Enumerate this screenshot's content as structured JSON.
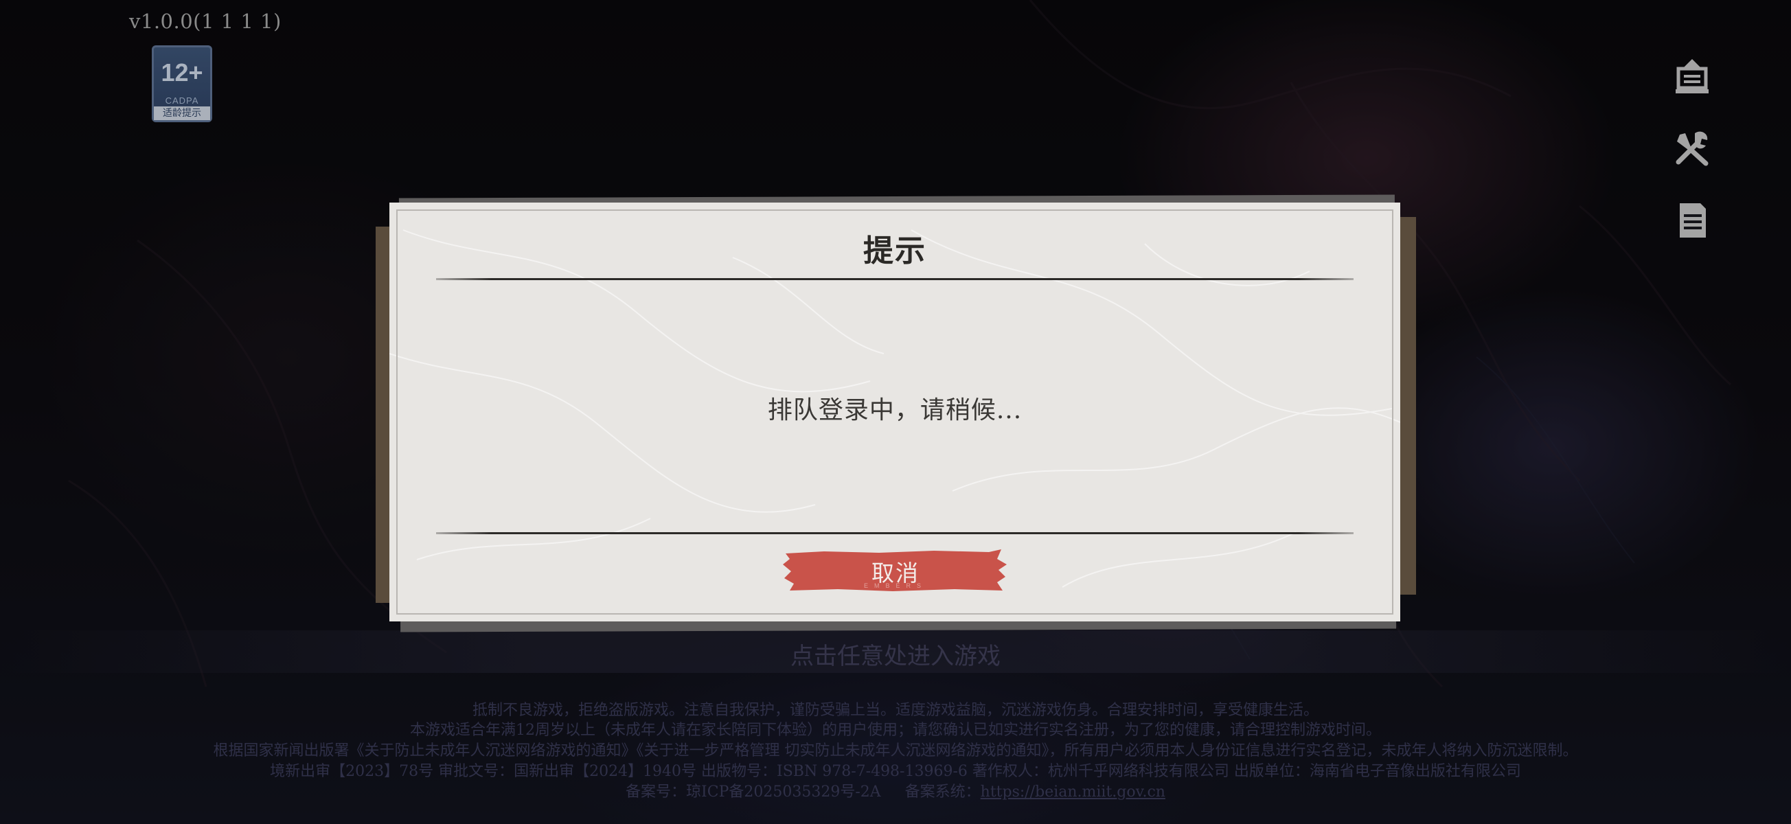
{
  "header": {
    "version": "v1.0.0(1 1 1 1)"
  },
  "age_rating": {
    "number": "12+",
    "org": "CADPA",
    "tip": "适龄提示"
  },
  "side_tools": [
    {
      "name": "notice-icon"
    },
    {
      "name": "repair-tools-icon"
    },
    {
      "name": "document-icon"
    }
  ],
  "dialog": {
    "title": "提示",
    "message": "排队登录中，请稍候...",
    "cancel_label": "取消",
    "cancel_sub": "EMBERS"
  },
  "bottom": {
    "enter_prompt": "点击任意处进入游戏",
    "legal_lines": [
      "抵制不良游戏，拒绝盗版游戏。注意自我保护，谨防受骗上当。适度游戏益脑，沉迷游戏伤身。合理安排时间，享受健康生活。",
      "本游戏适合年满12周岁以上（未成年人请在家长陪同下体验）的用户使用；请您确认已如实进行实名注册，为了您的健康，请合理控制游戏时间。",
      "根据国家新闻出版署《关于防止未成年人沉迷网络游戏的通知》《关于进一步严格管理 切实防止未成年人沉迷网络游戏的通知》，所有用户必须用本人身份证信息进行实名登记，未成年人将纳入防沉迷限制。",
      "境新出审【2023】78号 审批文号：国新出审【2024】1940号 出版物号：ISBN 978-7-498-13969-6 著作权人：杭州千乎网络科技有限公司 出版单位：海南省电子音像出版社有限公司"
    ],
    "icp_label": "备案号：琼ICP备2025035329号-2A",
    "icp_system_label": "备案系统：",
    "icp_link": "https://beian.miit.gov.cn"
  },
  "colors": {
    "dialog_bg": "#e8e6e3",
    "button_red": "#c9534a",
    "title_text": "#2b2926"
  }
}
